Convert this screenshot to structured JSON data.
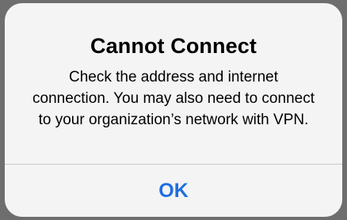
{
  "alert": {
    "title": "Cannot Connect",
    "message": "Check the address and internet connection. You may also need to connect to your organization’s network with VPN.",
    "action_label": "OK"
  },
  "colors": {
    "backdrop": "#6e6e6e",
    "alert_background": "#f4f4f4",
    "divider": "#c8c7cc",
    "action_accent": "#1f6fe0",
    "text": "#000000"
  }
}
